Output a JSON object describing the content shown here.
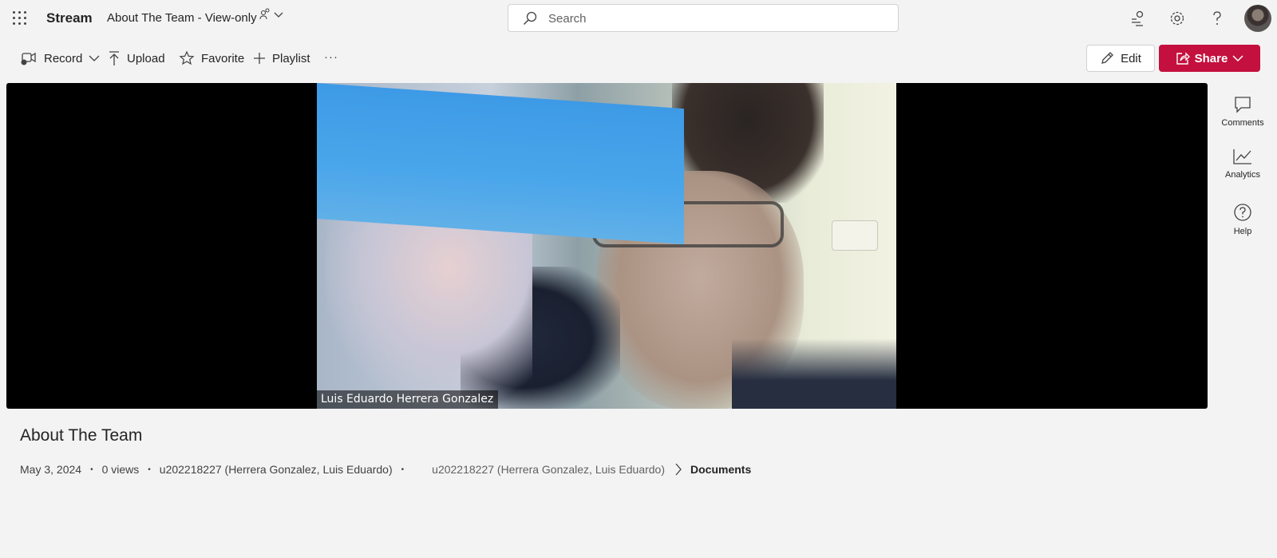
{
  "app": {
    "name": "Stream",
    "doc_title": "About The Team - View-only"
  },
  "search": {
    "placeholder": "Search"
  },
  "commands": {
    "record": "Record",
    "upload": "Upload",
    "favorite": "Favorite",
    "playlist": "Playlist",
    "more": "···",
    "edit": "Edit",
    "share": "Share"
  },
  "video": {
    "caption": "Luis Eduardo Herrera Gonzalez"
  },
  "rail": {
    "comments": "Comments",
    "analytics": "Analytics",
    "help": "Help"
  },
  "details": {
    "title": "About The Team",
    "date": "May 3, 2024",
    "views": "0 views",
    "owner": "u202218227 (Herrera Gonzalez, Luis Eduardo)",
    "owner_path": "u202218227 (Herrera Gonzalez, Luis Eduardo)",
    "location": "Documents",
    "separator": "•"
  },
  "colors": {
    "share_accent": "#c4103e",
    "background": "#f3f3f3"
  },
  "icons": [
    "app-launcher-icon",
    "people-icon",
    "chevron-down-icon",
    "search-icon",
    "feedback-icon",
    "gear-icon",
    "help-icon",
    "record-icon",
    "upload-icon",
    "star-icon",
    "plus-icon",
    "pencil-icon",
    "share-icon",
    "comment-icon",
    "analytics-icon",
    "help-circle-icon",
    "chevron-right-icon"
  ]
}
